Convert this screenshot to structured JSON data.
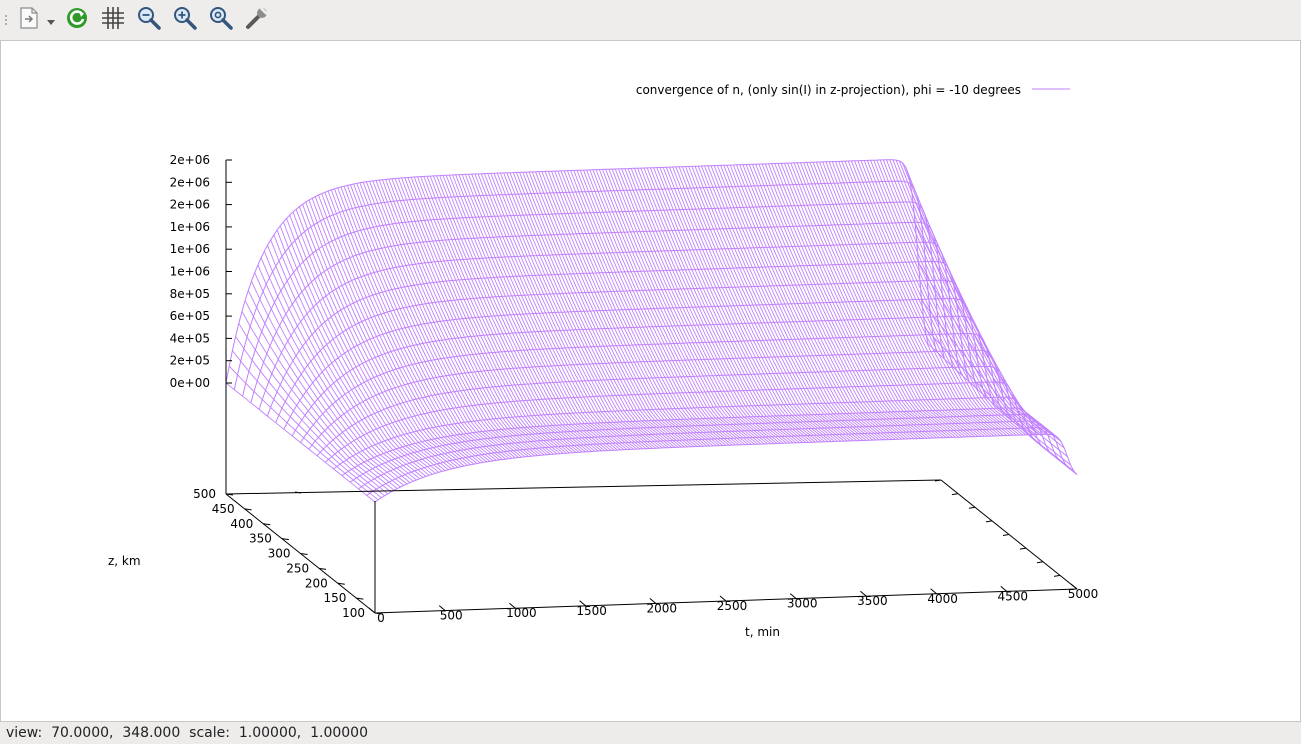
{
  "toolbar": {
    "buttons": [
      {
        "icon": "export-icon"
      },
      {
        "icon": "replot-icon"
      },
      {
        "icon": "grid-icon"
      },
      {
        "icon": "zoom-out-icon"
      },
      {
        "icon": "zoom-in-icon"
      },
      {
        "icon": "zoom-fit-icon"
      },
      {
        "icon": "settings-icon"
      }
    ]
  },
  "status": {
    "view_label": "view:",
    "view_value": "70.0000,  348.000",
    "scale_label": "scale:",
    "scale_value": "1.00000,  1.00000"
  },
  "chart_data": {
    "type": "surface",
    "title": "",
    "legend": {
      "label": "convergence of n, (only sin(I) in z-projection), phi = -10 degrees",
      "color": "#c080ff",
      "position": "top-right"
    },
    "xlabel": "t, min",
    "ylabel": "z, km",
    "zlabel": "",
    "xlim": [
      0,
      5000
    ],
    "ylim": [
      100,
      500
    ],
    "zlim": [
      0,
      2000000
    ],
    "x_ticks": [
      "0",
      "500",
      "1000",
      "1500",
      "2000",
      "2500",
      "3000",
      "3500",
      "4000",
      "4500",
      "5000"
    ],
    "y_ticks": [
      "100",
      "150",
      "200",
      "250",
      "300",
      "350",
      "400",
      "450",
      "500"
    ],
    "z_ticks": [
      "0e+00",
      "2e+05",
      "4e+05",
      "6e+05",
      "8e+05",
      "1e+06",
      "1e+06",
      "1e+06",
      "2e+06",
      "2e+06",
      "2e+06"
    ],
    "view": [
      70,
      348
    ],
    "surface_color": "#c080ff",
    "series": [
      {
        "z_km": 100,
        "t_min": [
          0,
          250,
          500,
          1000,
          2000,
          3000,
          4000,
          5000
        ],
        "n": [
          0,
          0,
          0,
          0,
          0,
          0,
          0,
          0
        ]
      },
      {
        "z_km": 300,
        "t_min": [
          0,
          250,
          500,
          1000,
          2000,
          3000,
          4000,
          5000
        ],
        "n": [
          0,
          200000,
          700000,
          1100000,
          1200000,
          1250000,
          1300000,
          1300000
        ]
      },
      {
        "z_km": 500,
        "t_min": [
          0,
          250,
          500,
          1000,
          2000,
          3000,
          4000,
          5000
        ],
        "n": [
          0,
          750000,
          1250000,
          1500000,
          1650000,
          1700000,
          1750000,
          1800000
        ]
      }
    ]
  }
}
